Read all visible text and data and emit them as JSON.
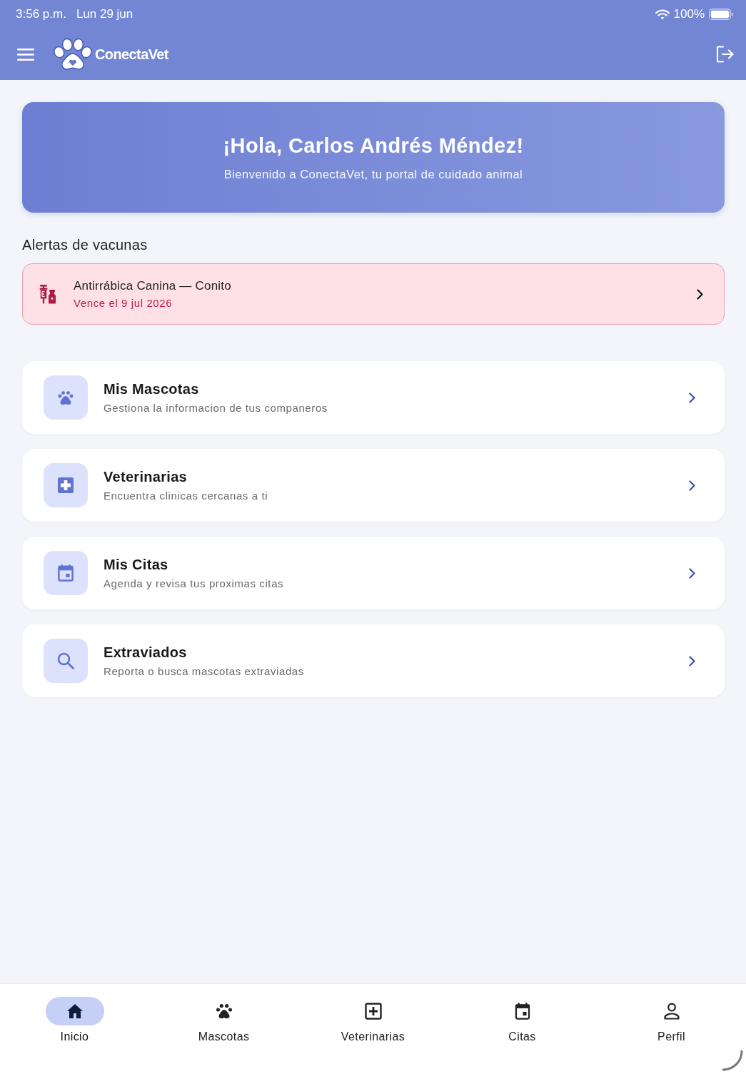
{
  "status_bar": {
    "time": "3:56 p.m.",
    "date": "Lun 29 jun",
    "battery": "100%"
  },
  "app_bar": {
    "app_name": "ConectaVet"
  },
  "banner": {
    "title": "¡Hola, Carlos Andrés Méndez!",
    "subtitle": "Bienvenido a ConectaVet, tu portal de cuidado animal"
  },
  "vaccine_alerts": {
    "heading": "Alertas de vacunas",
    "items": [
      {
        "title": "Antirrábica Canina — Conito",
        "due": "Vence el 9 jul 2026"
      }
    ]
  },
  "menu": [
    {
      "kind": "pets",
      "title": "Mis Mascotas",
      "subtitle": "Gestiona la informacion de tus companeros"
    },
    {
      "kind": "clinics",
      "title": "Veterinarias",
      "subtitle": "Encuentra clinicas cercanas a ti"
    },
    {
      "kind": "appointments",
      "title": "Mis Citas",
      "subtitle": "Agenda y revisa tus proximas citas"
    },
    {
      "kind": "lost",
      "title": "Extraviados",
      "subtitle": "Reporta o busca mascotas extraviadas"
    }
  ],
  "bottom_nav": [
    {
      "kind": "home",
      "label": "Inicio",
      "selected": true
    },
    {
      "kind": "pets",
      "label": "Mascotas",
      "selected": false
    },
    {
      "kind": "clinics",
      "label": "Veterinarias",
      "selected": false
    },
    {
      "kind": "appointments",
      "label": "Citas",
      "selected": false
    },
    {
      "kind": "profile",
      "label": "Perfil",
      "selected": false
    }
  ]
}
